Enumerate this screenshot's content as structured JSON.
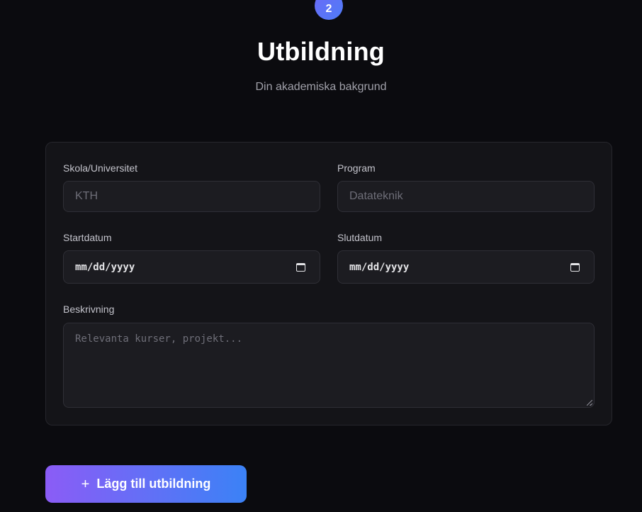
{
  "step": {
    "number": "2"
  },
  "header": {
    "title": "Utbildning",
    "subtitle": "Din akademiska bakgrund"
  },
  "form": {
    "school": {
      "label": "Skola/Universitet",
      "placeholder": "KTH",
      "value": ""
    },
    "program": {
      "label": "Program",
      "placeholder": "Datateknik",
      "value": ""
    },
    "start_date": {
      "label": "Startdatum",
      "value": "mm/dd/yyyy",
      "icon": "calendar-icon"
    },
    "end_date": {
      "label": "Slutdatum",
      "value": "mm/dd/yyyy",
      "icon": "calendar-icon"
    },
    "description": {
      "label": "Beskrivning",
      "placeholder": "Relevanta kurser, projekt..."
    }
  },
  "actions": {
    "add_icon": "+",
    "add_label": "Lägg till utbildning"
  },
  "colors": {
    "background": "#0b0b0f",
    "card": "#141418",
    "accent_start": "#8b5cf6",
    "accent_end": "#3b82f6"
  }
}
